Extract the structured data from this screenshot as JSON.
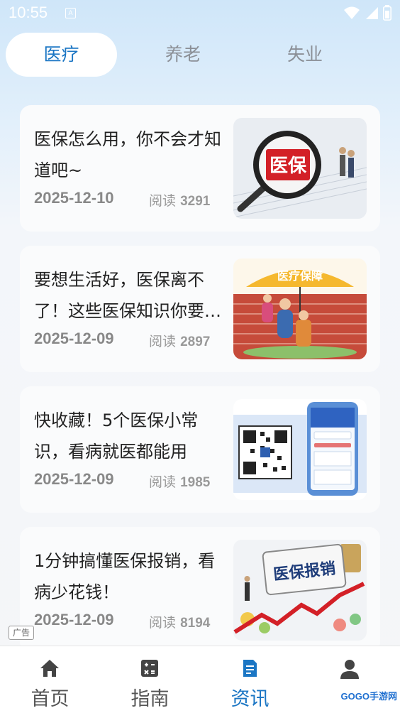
{
  "status_bar": {
    "time": "10:55",
    "notification_glyph": "A"
  },
  "tabs": [
    {
      "label": "医疗",
      "active": true
    },
    {
      "label": "养老",
      "active": false
    },
    {
      "label": "失业",
      "active": false
    }
  ],
  "articles": [
    {
      "title": "医保怎么用，你不会才知道吧~",
      "date": "2025-12-10",
      "read_label": "阅读",
      "read_count": "3291",
      "thumb_text": "医保"
    },
    {
      "title": "要想生活好，医保离不了！这些医保知识你要知道",
      "date": "2025-12-09",
      "read_label": "阅读",
      "read_count": "2897",
      "thumb_text": "医疗保障"
    },
    {
      "title": "快收藏！5个医保小常识，看病就医都能用",
      "date": "2025-12-09",
      "read_label": "阅读",
      "read_count": "1985",
      "thumb_text": ""
    },
    {
      "title": "1分钟搞懂医保报销，看病少花钱！",
      "date": "2025-12-09",
      "read_label": "阅读",
      "read_count": "8194",
      "thumb_text": "医保报销"
    }
  ],
  "ad_tag": "广告",
  "bottom_nav": [
    {
      "label": "首页",
      "icon": "home-icon",
      "active": false
    },
    {
      "label": "指南",
      "icon": "calculator-icon",
      "active": false
    },
    {
      "label": "资讯",
      "icon": "document-icon",
      "active": true
    },
    {
      "label": "我的",
      "icon": "user-icon",
      "active": false
    }
  ],
  "watermark": "GOGO手游网",
  "colors": {
    "accent": "#1b76c4",
    "inactive_tab": "#8b8f96",
    "card_bg": "#fafbfc"
  }
}
